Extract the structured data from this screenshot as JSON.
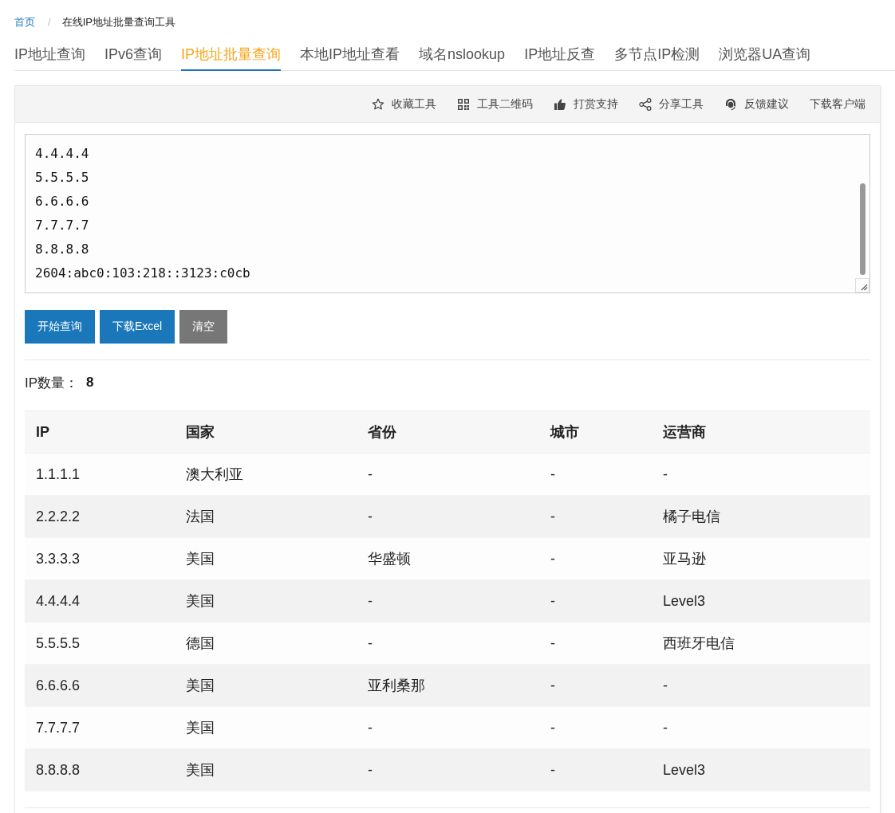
{
  "breadcrumb": {
    "items": [
      {
        "label": "首页",
        "kind": "link"
      },
      {
        "label": "在线IP地址批量查询工具",
        "kind": "current"
      }
    ],
    "separator": "/"
  },
  "tabs": [
    {
      "label": "IP地址查询",
      "selected": false
    },
    {
      "label": "IPv6查询",
      "selected": false
    },
    {
      "label": "IP地址批量查询",
      "selected": true
    },
    {
      "label": "本地IP地址查看",
      "selected": false
    },
    {
      "label": "域名nslookup",
      "selected": false
    },
    {
      "label": "IP地址反查",
      "selected": false
    },
    {
      "label": "多节点IP检测",
      "selected": false
    },
    {
      "label": "浏览器UA查询",
      "selected": false
    }
  ],
  "toolbar": [
    {
      "label": "收藏工具",
      "kind": "favorite"
    },
    {
      "label": "工具二维码",
      "kind": "qrcode"
    },
    {
      "label": "打赏支持",
      "kind": "tip"
    },
    {
      "label": "分享工具",
      "kind": "share"
    },
    {
      "label": "反馈建议",
      "kind": "feedback"
    },
    {
      "label": "下载客户端",
      "kind": "download"
    }
  ],
  "input": {
    "value": "4.4.4.4\n5.5.5.5\n6.6.6.6\n7.7.7.7\n8.8.8.8\n2604:abc0:103:218::3123:c0cb"
  },
  "buttons": [
    {
      "label": "开始查询",
      "kind": "primary"
    },
    {
      "label": "下载Excel",
      "kind": "primary"
    },
    {
      "label": "清空",
      "kind": "secondary"
    }
  ],
  "count": {
    "label": "IP数量：",
    "value": "8"
  },
  "table": {
    "columns": [
      "IP",
      "国家",
      "省份",
      "城市",
      "运营商"
    ],
    "rows": [
      [
        "1.1.1.1",
        "澳大利亚",
        "-",
        "-",
        "-"
      ],
      [
        "2.2.2.2",
        "法国",
        "-",
        "-",
        "橘子电信"
      ],
      [
        "3.3.3.3",
        "美国",
        "华盛顿",
        "-",
        "亚马逊"
      ],
      [
        "4.4.4.4",
        "美国",
        "-",
        "-",
        "Level3"
      ],
      [
        "5.5.5.5",
        "德国",
        "-",
        "-",
        "西班牙电信"
      ],
      [
        "6.6.6.6",
        "美国",
        "亚利桑那",
        "-",
        "-"
      ],
      [
        "7.7.7.7",
        "美国",
        "-",
        "-",
        "-"
      ],
      [
        "8.8.8.8",
        "美国",
        "-",
        "-",
        "Level3"
      ]
    ]
  }
}
